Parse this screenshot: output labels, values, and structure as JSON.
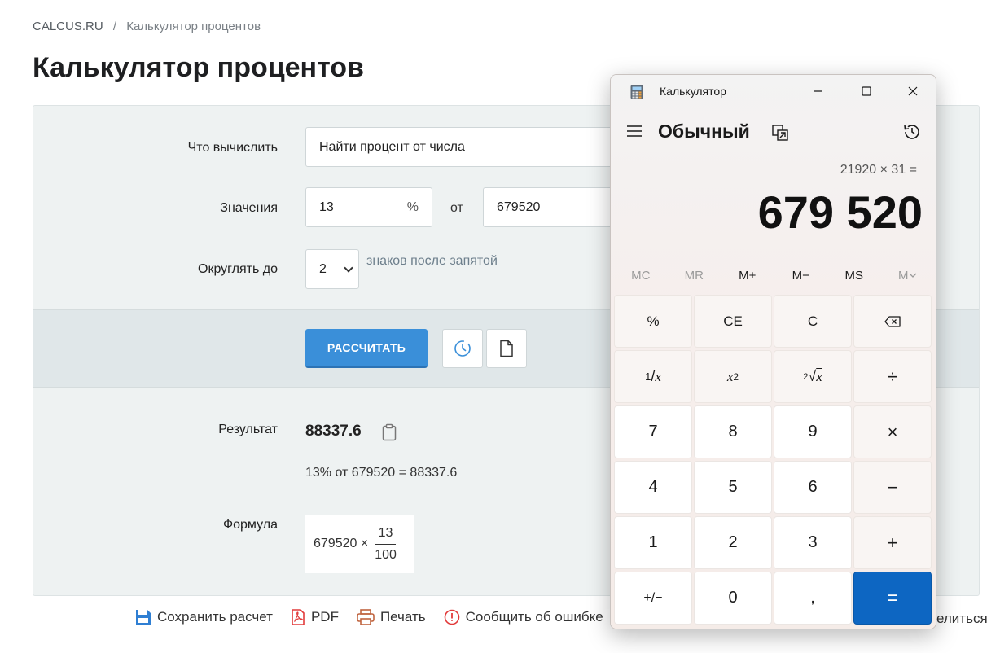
{
  "breadcrumb": {
    "home": "CALCUS.RU",
    "separator": "/",
    "current": "Калькулятор процентов"
  },
  "page_title": "Калькулятор процентов",
  "form": {
    "compute_label": "Что вычислить",
    "compute_value": "Найти процент от числа",
    "values_label": "Значения",
    "percent_value": "13",
    "percent_suffix": "%",
    "between_word": "от",
    "number_value": "679520",
    "round_label": "Округлять до",
    "round_value": "2",
    "round_hint": "знаков после запятой"
  },
  "actions": {
    "calculate_label": "РАССЧИТАТЬ",
    "history_icon": "clock-icon",
    "document_icon": "document-icon"
  },
  "result": {
    "label": "Результат",
    "value": "88337.6",
    "text": "13% от 679520 = 88337.6",
    "formula_label": "Формула",
    "formula_lhs": "679520 ×",
    "formula_numerator": "13",
    "formula_denominator": "100"
  },
  "footer": {
    "links": [
      "Сохранить расчет",
      "PDF",
      "Печать",
      "Сообщить об ошибке"
    ],
    "share_partial": "елиться"
  },
  "calculator": {
    "window_title": "Калькулятор",
    "mode": "Обычный",
    "expression": "21920 × 31 =",
    "display": "679 520",
    "memory": [
      "MC",
      "MR",
      "M+",
      "M−",
      "MS",
      "M"
    ],
    "memory_disabled": [
      "MC",
      "MR",
      "M"
    ],
    "keys": {
      "percent": "%",
      "ce": "CE",
      "c": "C",
      "reciprocal_num": "1",
      "reciprocal_den": "x",
      "square_base": "x",
      "square_exp": "2",
      "sqrt_index": "2",
      "sqrt_base": "x",
      "divide": "÷",
      "d7": "7",
      "d8": "8",
      "d9": "9",
      "multiply": "×",
      "d4": "4",
      "d5": "5",
      "d6": "6",
      "minus": "−",
      "d1": "1",
      "d2": "2",
      "d3": "3",
      "plus": "+",
      "negate": "+/−",
      "d0": "0",
      "decimal": ",",
      "equals": "="
    }
  },
  "colors": {
    "accent_button": "#3a8fd9",
    "equals_key": "#0d66c2",
    "link_icon_blue": "#2f7fd3",
    "link_icon_red": "#e23b3b",
    "link_icon_brown": "#c0643f"
  }
}
